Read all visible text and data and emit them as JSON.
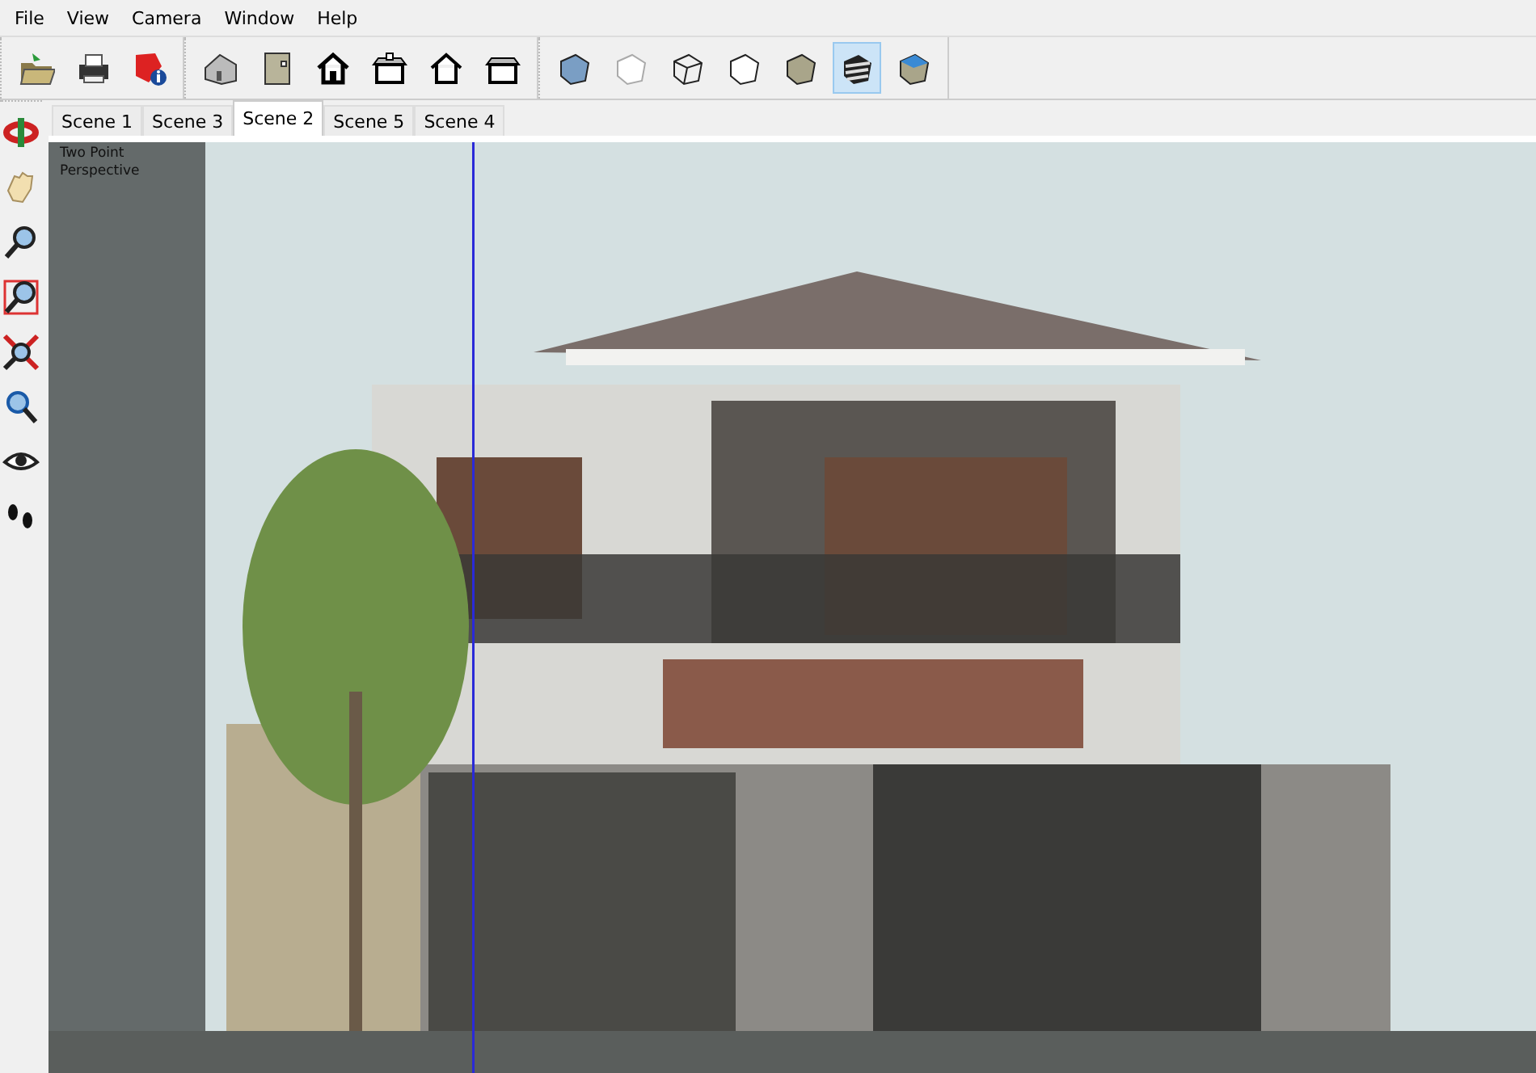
{
  "menu": [
    "File",
    "View",
    "Camera",
    "Window",
    "Help"
  ],
  "toolbar_groups": [
    [
      {
        "kind": "open",
        "selected": false
      },
      {
        "kind": "print",
        "selected": false
      },
      {
        "kind": "model-info",
        "selected": false
      }
    ],
    [
      {
        "kind": "iso",
        "selected": false
      },
      {
        "kind": "top",
        "selected": false
      },
      {
        "kind": "front",
        "selected": false
      },
      {
        "kind": "right",
        "selected": false
      },
      {
        "kind": "back",
        "selected": false
      },
      {
        "kind": "left",
        "selected": false
      }
    ],
    [
      {
        "kind": "xray",
        "selected": false
      },
      {
        "kind": "backedges",
        "selected": false
      },
      {
        "kind": "wireframe",
        "selected": false
      },
      {
        "kind": "hidden",
        "selected": false
      },
      {
        "kind": "shaded",
        "selected": false
      },
      {
        "kind": "textured",
        "selected": true
      },
      {
        "kind": "monochrome",
        "selected": false
      }
    ]
  ],
  "scene_tabs": [
    {
      "label": "Scene 1",
      "selected": false
    },
    {
      "label": "Scene 3",
      "selected": false
    },
    {
      "label": "Scene 2",
      "selected": true
    },
    {
      "label": "Scene 5",
      "selected": false
    },
    {
      "label": "Scene 4",
      "selected": false
    }
  ],
  "side_tools": [
    {
      "kind": "orbit",
      "selected": false
    },
    {
      "kind": "pan",
      "selected": false
    },
    {
      "kind": "zoom",
      "selected": false
    },
    {
      "kind": "zoom-window",
      "selected": false
    },
    {
      "kind": "zoom-extents",
      "selected": false
    },
    {
      "kind": "previous",
      "selected": false
    },
    {
      "kind": "look-around",
      "selected": false
    },
    {
      "kind": "walk",
      "selected": false
    }
  ],
  "viewport": {
    "camera_label": "Two Point\nPerspective"
  }
}
